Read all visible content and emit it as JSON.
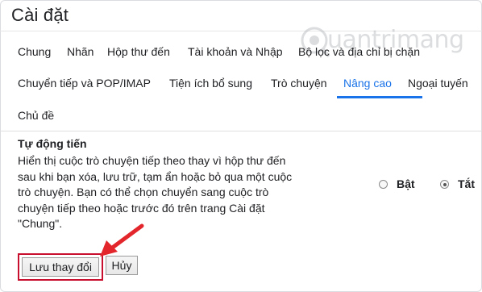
{
  "page": {
    "title": "Cài đặt"
  },
  "watermark": {
    "text": "uantrimang"
  },
  "tabs": {
    "row1": [
      {
        "label": "Chung"
      },
      {
        "label": "Nhãn"
      },
      {
        "label": "Hộp thư đến"
      },
      {
        "label": "Tài khoản và Nhập"
      },
      {
        "label": "Bộ lọc và địa chỉ bị chặn"
      }
    ],
    "row2": [
      {
        "label": "Chuyển tiếp và POP/IMAP"
      },
      {
        "label": "Tiện ích bổ sung"
      },
      {
        "label": "Trò chuyện"
      },
      {
        "label": "Nâng cao",
        "active": true
      },
      {
        "label": "Ngoại tuyến"
      }
    ],
    "row3": [
      {
        "label": "Chủ đề"
      }
    ]
  },
  "setting": {
    "title": "Tự động tiến",
    "description": "Hiển thị cuộc trò chuyện tiếp theo thay vì hộp thư đến sau khi bạn xóa, lưu trữ, tạm ẩn hoặc bỏ qua một cuộc trò chuyện. Bạn có thể chọn chuyển sang cuộc trò chuyện tiếp theo hoặc trước đó trên trang Cài đặt \"Chung\".",
    "options": [
      {
        "label": "Bật",
        "checked": false
      },
      {
        "label": "Tắt",
        "checked": true
      }
    ]
  },
  "buttons": {
    "save": "Lưu thay đổi",
    "cancel": "Hủy"
  },
  "colors": {
    "accent": "#1a73e8",
    "highlight": "#c8102e",
    "arrow": "#e3262b"
  }
}
